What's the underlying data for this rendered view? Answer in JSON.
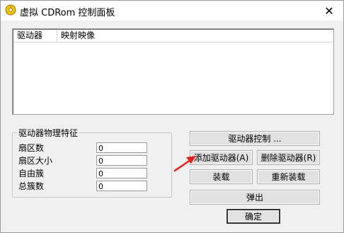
{
  "window": {
    "title": "虚拟 CDRom 控制面板",
    "close_glyph": "✕",
    "icon": "cd-app-icon"
  },
  "list": {
    "columns": [
      "驱动器",
      "映射映像"
    ],
    "rows": []
  },
  "properties": {
    "title": "驱动器物理特征",
    "items": [
      {
        "label": "扇区数",
        "value": "0"
      },
      {
        "label": "扇区大小",
        "value": "0"
      },
      {
        "label": "自由簇",
        "value": "0"
      },
      {
        "label": "总簇数",
        "value": "0"
      }
    ]
  },
  "buttons": {
    "drive_control": "驱动器控制 ...",
    "add_drive": "添加驱动器(A)",
    "remove_drive": "删除驱动器(R)",
    "mount": "装载",
    "remount": "重新装载",
    "eject": "弹出",
    "ok": "确定"
  },
  "colors": {
    "annotation_arrow": "#e8201a",
    "background": "#f0f0f0"
  }
}
